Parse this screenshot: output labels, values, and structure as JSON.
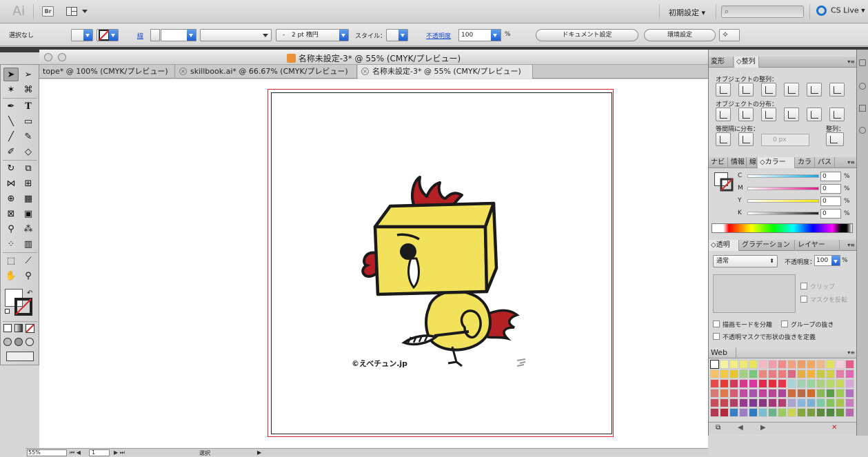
{
  "app": {
    "logo": "Ai",
    "bridge_label": "Br",
    "workspace": "初期設定 ▾",
    "search_placeholder": "",
    "cs_live": "CS Live ▾"
  },
  "control_bar": {
    "selection": "選択なし",
    "stroke_label": "線",
    "stroke_weight": "2 pt 楕円",
    "stroke_weight_dash": "-",
    "style_label": "スタイル：",
    "opacity_label": "不透明度",
    "opacity_value": "100",
    "opacity_unit": "%",
    "doc_setup": "ドキュメント設定",
    "prefs": "環境設定"
  },
  "document": {
    "window_title": "名称未設定-3* @ 55% (CMYK/プレビュー)",
    "tabs": [
      {
        "label": "tope* @ 100% (CMYK/プレビュー)"
      },
      {
        "label": "skillbook.ai* @ 66.67% (CMYK/プレビュー)"
      },
      {
        "label": "名称未設定-3* @ 55% (CMYK/プレビュー)"
      }
    ],
    "art_caption": "©えべチュン.jp",
    "zoom": "55%",
    "page": "1",
    "status": "選択"
  },
  "panels": {
    "align_tabs": [
      "変形",
      "◇整列"
    ],
    "align_objects": "オブジェクトの整列：",
    "distribute_objects": "オブジェクトの分布：",
    "distribute_spacing": "等間隔に分布：",
    "spacing_value": "0 px",
    "align_to": "整列：",
    "color_tabs": [
      "ナビ",
      "情報",
      "線",
      "◇カラー",
      "カラ",
      "パス"
    ],
    "color_channels": [
      {
        "label": "C",
        "value": "0"
      },
      {
        "label": "M",
        "value": "0"
      },
      {
        "label": "Y",
        "value": "0"
      },
      {
        "label": "K",
        "value": "0"
      }
    ],
    "percent": "%",
    "transparency_tabs": [
      "◇透明",
      "グラデーション",
      "レイヤー"
    ],
    "blend_mode": "通常",
    "opacity_label": "不透明度：",
    "opacity_value": "100",
    "clip": "クリップ",
    "invert_mask": "マスクを反転",
    "isolate_blend": "描画モードを分離",
    "knockout_group": "グループの抜き",
    "opacity_mask_knockout": "不透明マスクで形状の抜きを定義",
    "swatch_library": "Web"
  },
  "colors": {
    "accent_blue": "#1e5fd0",
    "artboard_border": "#d42a2a",
    "chicken_body": "#f2e15a",
    "comb": "#b52025"
  },
  "swatches": [
    "#ffffff",
    "#f6f3a0",
    "#f2ee82",
    "#ece873",
    "#e8e35c",
    "#f4b8c4",
    "#f19cab",
    "#ef8b8b",
    "#f2a27f",
    "#ef9c6b",
    "#f0a960",
    "#efb88a",
    "#e2e25d",
    "#f2d0d9",
    "#e45b8a",
    "#f7c06b",
    "#f2c845",
    "#e9c62e",
    "#9fd17f",
    "#78c67e",
    "#e78a7b",
    "#e97c83",
    "#eb7c7c",
    "#d96a7f",
    "#e7ad47",
    "#f2b13d",
    "#c8c84a",
    "#d2cd4a",
    "#e37ea6",
    "#e068b3",
    "#e44b4b",
    "#e63a3a",
    "#d23a58",
    "#d73a8a",
    "#d8369f",
    "#e3264e",
    "#e62d3d",
    "#e8354d",
    "#a7d5d8",
    "#9fd1b4",
    "#98d49e",
    "#a8d183",
    "#b7d86a",
    "#c7d95a",
    "#d8a6d8",
    "#d67b74",
    "#e1774a",
    "#d75d77",
    "#c04da4",
    "#a854ad",
    "#c2429c",
    "#b84696",
    "#a9479a",
    "#cb6b3f",
    "#bc6a4a",
    "#d06b2c",
    "#8db85b",
    "#5c9d4a",
    "#9bcc51",
    "#b071c1",
    "#c74f5b",
    "#c64652",
    "#b33e68",
    "#96398f",
    "#7d3a8e",
    "#8b3882",
    "#a6377b",
    "#b43f73",
    "#a8a4d0",
    "#8ab5df",
    "#7bb2d3",
    "#7ccba4",
    "#86c35c",
    "#a7c74b",
    "#c77dbd",
    "#b23a4e",
    "#b52b3b",
    "#3a7fc4",
    "#9b7dc4",
    "#2f7ac1",
    "#7abfcf",
    "#69b28a",
    "#9acb62",
    "#c9d653",
    "#87a83c",
    "#7d9d43",
    "#5c8c3b",
    "#4f8a42",
    "#6a9c39",
    "#b76aa9"
  ]
}
